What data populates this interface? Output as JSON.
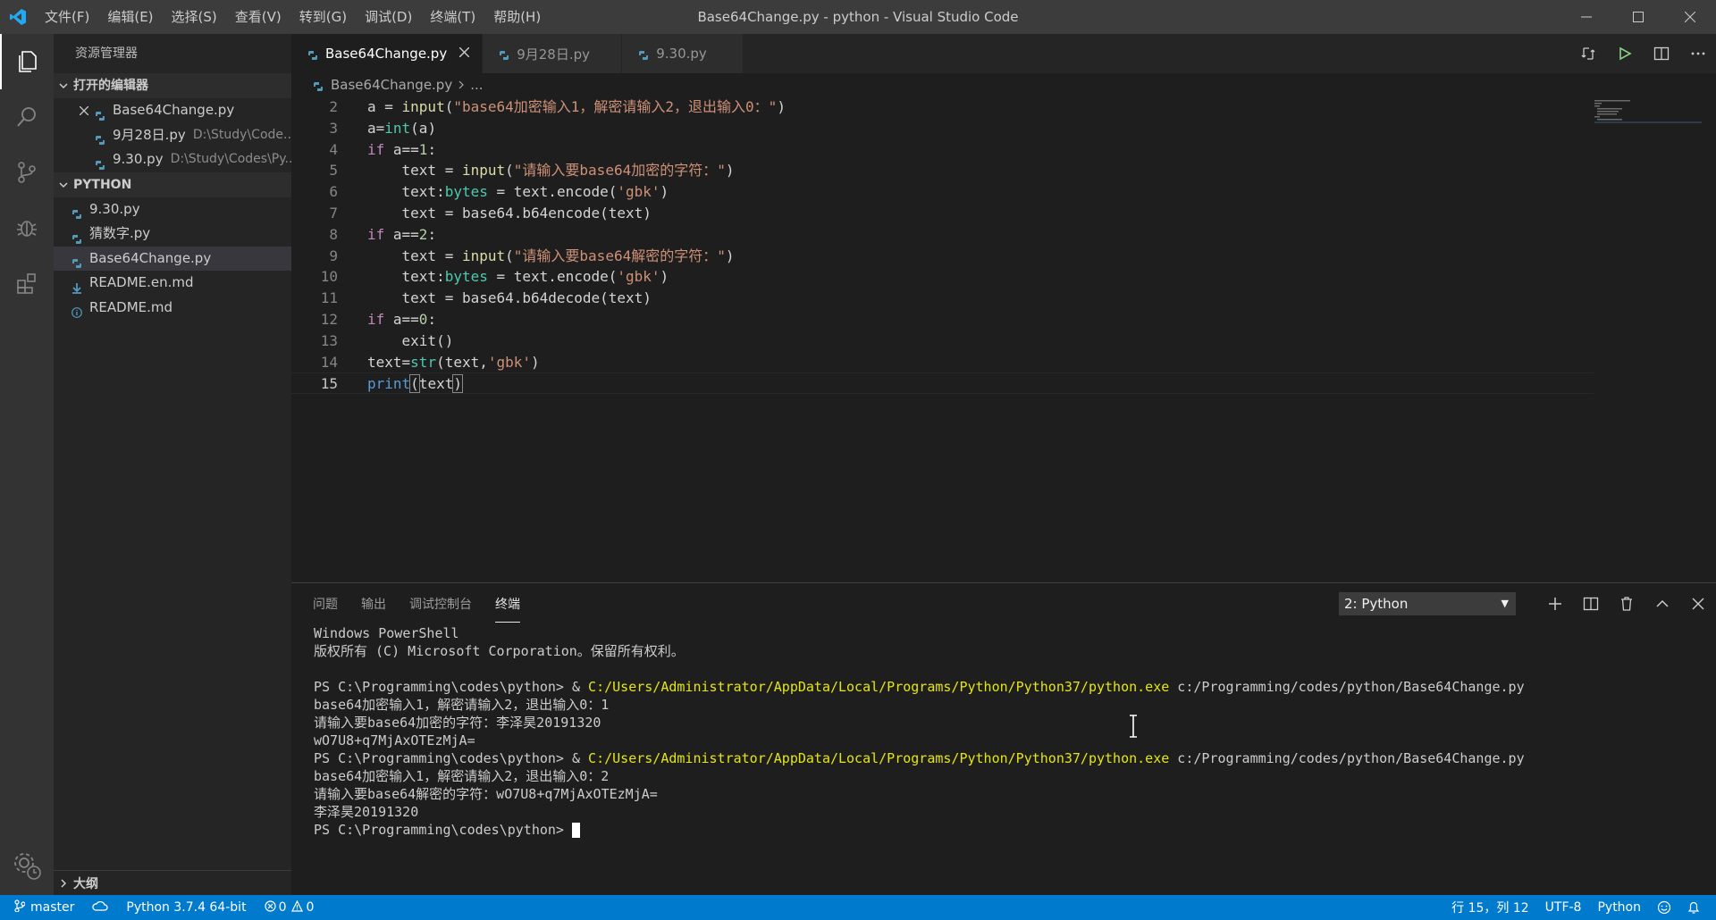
{
  "window": {
    "title": "Base64Change.py - python - Visual Studio Code",
    "menu": [
      "文件(F)",
      "编辑(E)",
      "选择(S)",
      "查看(V)",
      "转到(G)",
      "调试(D)",
      "终端(T)",
      "帮助(H)"
    ]
  },
  "sidebar": {
    "title": "资源管理器",
    "open_editors_label": "打开的编辑器",
    "open_editors": [
      {
        "name": "Base64Change.py",
        "path": ""
      },
      {
        "name": "9月28日.py",
        "path": "D:\\Study\\Code..."
      },
      {
        "name": "9.30.py",
        "path": "D:\\Study\\Codes\\Py..."
      }
    ],
    "folder_label": "PYTHON",
    "files": [
      {
        "name": "9.30.py"
      },
      {
        "name": "猜数字.py"
      },
      {
        "name": "Base64Change.py"
      },
      {
        "name": "README.en.md"
      },
      {
        "name": "README.md"
      }
    ],
    "outline_label": "大纲"
  },
  "tabs": [
    {
      "label": "Base64Change.py"
    },
    {
      "label": "9月28日.py"
    },
    {
      "label": "9.30.py"
    }
  ],
  "breadcrumb": {
    "file": "Base64Change.py",
    "rest": "..."
  },
  "editor": {
    "line_numbers": [
      "2",
      "3",
      "4",
      "5",
      "6",
      "7",
      "8",
      "9",
      "10",
      "11",
      "12",
      "13",
      "14",
      "15"
    ]
  },
  "panel": {
    "tabs": [
      "问题",
      "输出",
      "调试控制台",
      "终端"
    ],
    "terminal_select": "2: Python",
    "lines": [
      "Windows PowerShell",
      "版权所有 (C) Microsoft Corporation。保留所有权利。",
      "",
      "PS C:\\Programming\\codes\\python> & ",
      "base64加密输入1，解密请输入2，退出输入0：1",
      "请输入要base64加密的字符：李泽昊20191320",
      "wO7U8+q7MjAxOTEzMjA=",
      "PS C:\\Programming\\codes\\python> & ",
      "base64加密输入1，解密请输入2，退出输入0：2",
      "请输入要base64解密的字符：wO7U8+q7MjAxOTEzMjA=",
      "李泽昊20191320",
      "PS C:\\Programming\\codes\\python> "
    ],
    "exe_path": "C:/Users/Administrator/AppData/Local/Programs/Python/Python37/python.exe",
    "script_arg": " c:/Programming/codes/python/Base64Change.py"
  },
  "status": {
    "branch": "master",
    "interpreter": "Python 3.7.4 64-bit",
    "errors": "0",
    "warnings": "0",
    "position": "行 15，列 12",
    "encoding": "UTF-8",
    "language": "Python"
  },
  "colors": {
    "accent": "#007acc",
    "python_icon": "#519aba"
  }
}
